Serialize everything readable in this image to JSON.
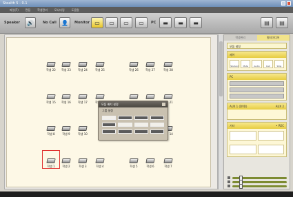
{
  "window": {
    "title": "Stealth 5 - 0.1"
  },
  "menu": [
    "파일(F)",
    "편집",
    "학생관리",
    "모니터링",
    "도움말"
  ],
  "toolbar": {
    "speaker_label": "Speaker",
    "no_call_label": "No Call",
    "monitor_label": "Monitor",
    "pc_label": "PC"
  },
  "students": [
    {
      "label": "학생 22"
    },
    {
      "label": "학생 23"
    },
    {
      "label": "학생 24"
    },
    {
      "label": "학생 25"
    },
    {
      "label": "학생 26"
    },
    {
      "label": "학생 27"
    },
    {
      "label": "학생 28"
    },
    {
      "label": "학생 15"
    },
    {
      "label": "학생 16"
    },
    {
      "label": "학생 17"
    },
    {
      "label": "학생 18"
    },
    {
      "label": "학생 19"
    },
    {
      "label": "학생 20"
    },
    {
      "label": "학생 21"
    },
    {
      "label": "학생 8"
    },
    {
      "label": "학생 9"
    },
    {
      "label": "학생 10"
    },
    {
      "label": "학생 12"
    },
    {
      "label": "학생 13"
    },
    {
      "label": "학생 14"
    },
    {
      "label": "학생 1"
    },
    {
      "label": "학생 2"
    },
    {
      "label": "학생 3"
    },
    {
      "label": "학생 4"
    },
    {
      "label": "학생 5"
    },
    {
      "label": "학생 6"
    },
    {
      "label": "학생 7"
    }
  ],
  "dialog": {
    "title": "모둠 배치 설정",
    "section": "그룹 설정"
  },
  "right_panel": {
    "tabs": [
      "학생관리",
      "멀티미디어"
    ],
    "top_button": "모둠 설정",
    "group1_title": "제어",
    "group1_buttons": [
      "Student",
      "Mute",
      "Audio",
      "Call",
      "Stop"
    ],
    "group2_title": "PC",
    "group3_title": "AUX 1 (DVD)",
    "group3_badge": "AUX 2",
    "group4_title": "기타",
    "group4_badge": "• REC"
  }
}
